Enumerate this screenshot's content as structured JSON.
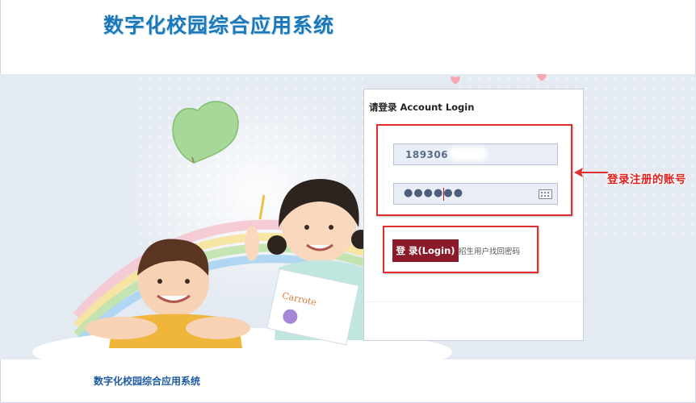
{
  "header": {
    "title": "数字化校园综合应用系统"
  },
  "login": {
    "panel_title": "请登录 Account Login",
    "username_value": "189306",
    "password_mask": "●●●●●●",
    "login_button": "登 录(Login)",
    "recover_link": "招生用户找回密码"
  },
  "annotation": {
    "callout": "登录注册的账号"
  },
  "footer": {
    "title": "数字化校园综合应用系统"
  },
  "icons": [
    "heart-balloon-icon",
    "keyboard-icon",
    "arrow-left-icon"
  ],
  "colors": {
    "accent": "#8b1a2b",
    "highlight": "#e02e2e",
    "title": "#1e78b8"
  }
}
